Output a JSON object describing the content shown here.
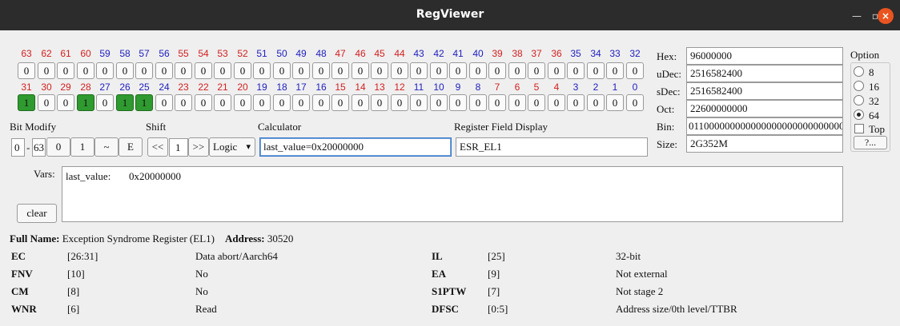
{
  "window": {
    "title": "RegViewer",
    "min_glyph": "—",
    "max_glyph": "▫",
    "close_glyph": "×"
  },
  "bits": {
    "upper_numbers": [
      "63",
      "62",
      "61",
      "60",
      "59",
      "58",
      "57",
      "56",
      "55",
      "54",
      "53",
      "52",
      "51",
      "50",
      "49",
      "48",
      "47",
      "46",
      "45",
      "44",
      "43",
      "42",
      "41",
      "40",
      "39",
      "38",
      "37",
      "36",
      "35",
      "34",
      "33",
      "32"
    ],
    "upper_values": [
      "0",
      "0",
      "0",
      "0",
      "0",
      "0",
      "0",
      "0",
      "0",
      "0",
      "0",
      "0",
      "0",
      "0",
      "0",
      "0",
      "0",
      "0",
      "0",
      "0",
      "0",
      "0",
      "0",
      "0",
      "0",
      "0",
      "0",
      "0",
      "0",
      "0",
      "0",
      "0"
    ],
    "lower_numbers": [
      "31",
      "30",
      "29",
      "28",
      "27",
      "26",
      "25",
      "24",
      "23",
      "22",
      "21",
      "20",
      "19",
      "18",
      "17",
      "16",
      "15",
      "14",
      "13",
      "12",
      "11",
      "10",
      "9",
      "8",
      "7",
      "6",
      "5",
      "4",
      "3",
      "2",
      "1",
      "0"
    ],
    "lower_values": [
      "1",
      "0",
      "0",
      "1",
      "0",
      "1",
      "1",
      "0",
      "0",
      "0",
      "0",
      "0",
      "0",
      "0",
      "0",
      "0",
      "0",
      "0",
      "0",
      "0",
      "0",
      "0",
      "0",
      "0",
      "0",
      "0",
      "0",
      "0",
      "0",
      "0",
      "0",
      "0"
    ],
    "number_colors": [
      "red",
      "red",
      "red",
      "red",
      "blue",
      "blue",
      "blue",
      "blue",
      "red",
      "red",
      "red",
      "red",
      "blue",
      "blue",
      "blue",
      "blue",
      "red",
      "red",
      "red",
      "red",
      "blue",
      "blue",
      "blue",
      "blue",
      "red",
      "red",
      "red",
      "red",
      "blue",
      "blue",
      "blue",
      "blue"
    ]
  },
  "bit_modify": {
    "label": "Bit Modify",
    "from": "0",
    "sep": "-",
    "to": "63",
    "set0": "0",
    "set1": "1",
    "invert": "~",
    "e": "E"
  },
  "shift": {
    "label": "Shift",
    "left": "<<",
    "amount": "1",
    "right": ">>",
    "mode": "Logic",
    "arrow": "▾"
  },
  "calculator": {
    "label": "Calculator",
    "value": "last_value=0x20000000"
  },
  "field_display": {
    "label": "Register Field Display",
    "value": "ESR_EL1"
  },
  "values": {
    "hex_label": "Hex:",
    "hex": "96000000",
    "udec_label": "uDec:",
    "udec": "2516582400",
    "sdec_label": "sDec:",
    "sdec": "2516582400",
    "oct_label": "Oct:",
    "oct": "22600000000",
    "bin_label": "Bin:",
    "bin": "011000000000000000000000000000",
    "size_label": "Size:",
    "size": "2G352M"
  },
  "option": {
    "label": "Option",
    "choices": [
      "8",
      "16",
      "32",
      "64"
    ],
    "selected": "64",
    "top_label": "Top",
    "more": "?..."
  },
  "vars": {
    "label": "Vars:",
    "clear": "clear",
    "name": "last_value:",
    "value": "0x20000000"
  },
  "register": {
    "full_name_label": "Full Name:",
    "full_name": "Exception Syndrome Register (EL1)",
    "address_label": "Address:",
    "address": "30520"
  },
  "fields_left": [
    {
      "name": "EC",
      "range": "[26:31]",
      "desc": "Data abort/Aarch64"
    },
    {
      "name": "FNV",
      "range": "[10]",
      "desc": "No"
    },
    {
      "name": "CM",
      "range": "[8]",
      "desc": "No"
    },
    {
      "name": "WNR",
      "range": "[6]",
      "desc": "Read"
    }
  ],
  "fields_right": [
    {
      "name": "IL",
      "range": "[25]",
      "desc": "32-bit"
    },
    {
      "name": "EA",
      "range": "[9]",
      "desc": "Not external"
    },
    {
      "name": "S1PTW",
      "range": "[7]",
      "desc": "Not stage 2"
    },
    {
      "name": "DFSC",
      "range": "[0:5]",
      "desc": "Address size/0th level/TTBR"
    }
  ]
}
